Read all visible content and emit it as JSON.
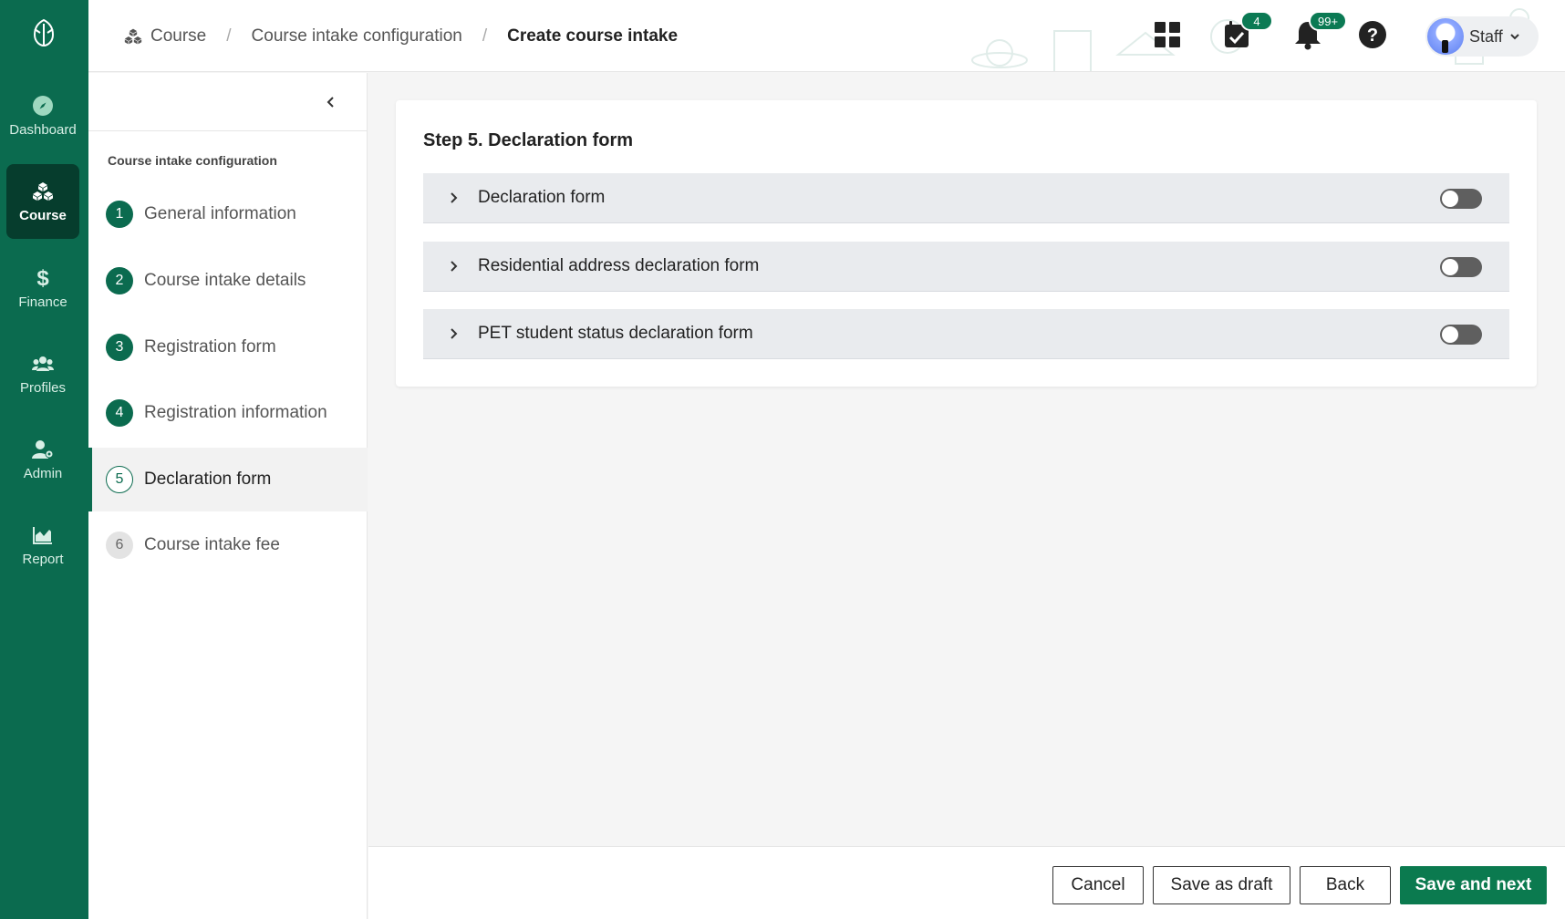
{
  "nav": {
    "items": [
      {
        "label": "Dashboard",
        "icon": "compass-icon"
      },
      {
        "label": "Course",
        "icon": "course-boxes-icon"
      },
      {
        "label": "Finance",
        "icon": "dollar-icon"
      },
      {
        "label": "Profiles",
        "icon": "users-icon"
      },
      {
        "label": "Admin",
        "icon": "user-gear-icon"
      },
      {
        "label": "Report",
        "icon": "area-chart-icon"
      }
    ],
    "active": "Course"
  },
  "breadcrumb": {
    "items": [
      "Course",
      "Course intake configuration",
      "Create course intake"
    ]
  },
  "header": {
    "tasks_badge": "4",
    "notifications_badge": "99+",
    "user_label": "Staff"
  },
  "steps": {
    "heading": "Course intake configuration",
    "items": [
      {
        "number": "1",
        "label": "General information",
        "state": "done"
      },
      {
        "number": "2",
        "label": "Course intake details",
        "state": "done"
      },
      {
        "number": "3",
        "label": "Registration form",
        "state": "done"
      },
      {
        "number": "4",
        "label": "Registration information",
        "state": "done"
      },
      {
        "number": "5",
        "label": "Declaration form",
        "state": "current"
      },
      {
        "number": "6",
        "label": "Course intake fee",
        "state": "todo"
      }
    ]
  },
  "main": {
    "title": "Step 5. Declaration form",
    "sections": [
      {
        "label": "Declaration form",
        "enabled": false
      },
      {
        "label": "Residential address declaration form",
        "enabled": false
      },
      {
        "label": "PET student status declaration form",
        "enabled": false
      }
    ]
  },
  "footer": {
    "cancel": "Cancel",
    "save_draft": "Save as draft",
    "back": "Back",
    "save_next": "Save and next"
  },
  "colors": {
    "brand": "#0b6b4f",
    "brand_dark": "#063d2d",
    "primary_button": "#0b7a4f",
    "accordion_bg": "#e9ebee"
  }
}
